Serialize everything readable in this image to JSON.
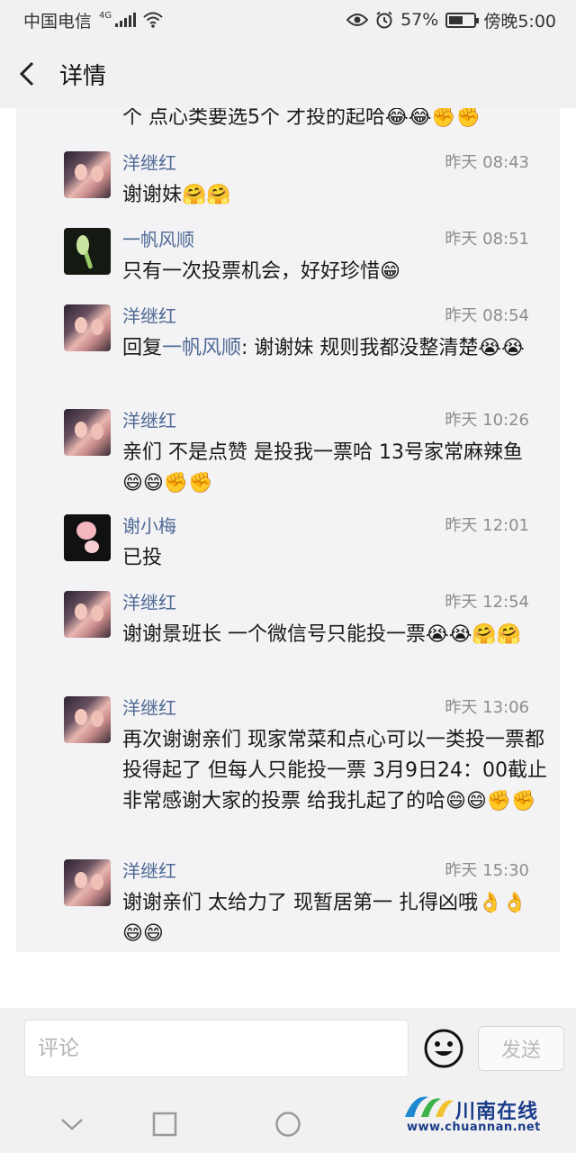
{
  "status_bar": {
    "carrier": "中国电信",
    "network": "4G",
    "battery": "57%",
    "battery_level": 0.57,
    "time": "傍晚5:00"
  },
  "nav": {
    "title": "详情"
  },
  "partial_comment_text": "个 点心类要选5个 才投的起哈😂😂✊✊",
  "comments": [
    {
      "name": "洋继红",
      "time": "昨天 08:43",
      "text": "谢谢妹🤗🤗",
      "avatar": "yang"
    },
    {
      "name": "一帆风顺",
      "time": "昨天 08:51",
      "text": "只有一次投票机会，好好珍惜😁",
      "avatar": "fan"
    },
    {
      "name": "洋继红",
      "time": "昨天 08:54",
      "reply_prefix": "回复",
      "reply_to": "一帆风顺",
      "text": ": 谢谢妹 规则我都没整清楚😭😭",
      "avatar": "yang"
    },
    {
      "name": "洋继红",
      "time": "昨天 10:26",
      "text": "亲们 不是点赞 是投我一票哈 13号家常麻辣鱼 😄😄✊✊",
      "avatar": "yang"
    },
    {
      "name": "谢小梅",
      "time": "昨天 12:01",
      "text": "已投",
      "avatar": "xie"
    },
    {
      "name": "洋继红",
      "time": "昨天 12:54",
      "text": "谢谢景班长 一个微信号只能投一票😭😭🤗🤗",
      "avatar": "yang"
    },
    {
      "name": "洋继红",
      "time": "昨天 13:06",
      "text": "再次谢谢亲们 现家常菜和点心可以一类投一票都投得起了 但每人只能投一票  3月9日24：00截止 非常感谢大家的投票 给我扎起了的哈😄😄✊✊",
      "avatar": "yang"
    },
    {
      "name": "洋继红",
      "time": "昨天 15:30",
      "text": "谢谢亲们 太给力了 现暂居第一 扎得凶哦👌👌😄😄",
      "avatar": "yang"
    }
  ],
  "input": {
    "placeholder": "评论",
    "send_label": "发送"
  },
  "watermark": {
    "name": "川南在线",
    "url": "www.chuannan.net"
  },
  "icons": {
    "back": "back-arrow-icon",
    "smiley": "smiley-icon",
    "sys_back": "triangle-back-icon",
    "sys_home": "circle-home-icon",
    "sys_recent": "square-recent-icon"
  }
}
